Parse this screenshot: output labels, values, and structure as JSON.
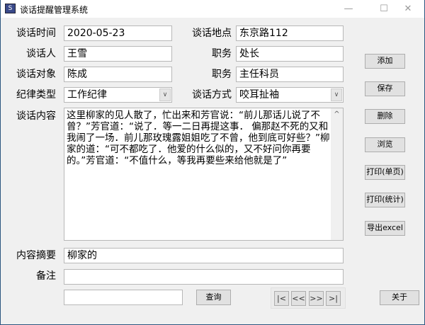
{
  "window": {
    "title": "谈话提醒管理系统",
    "icon": "app-icon",
    "minimize": "—",
    "maximize": "☐",
    "close": "✕"
  },
  "form": {
    "talk_time": {
      "label": "谈话时间",
      "value": "2020-05-23"
    },
    "talk_place": {
      "label": "谈话地点",
      "value": "东京路112"
    },
    "talker": {
      "label": "谈话人",
      "value": "王雪"
    },
    "talker_post": {
      "label": "职务",
      "value": "处长"
    },
    "target": {
      "label": "谈话对象",
      "value": "陈成"
    },
    "target_post": {
      "label": "职务",
      "value": "主任科员"
    },
    "discipline_type": {
      "label": "纪律类型",
      "value": "工作纪律"
    },
    "talk_method": {
      "label": "谈话方式",
      "value": "咬耳扯袖"
    },
    "content": {
      "label": "谈话内容",
      "value": "这里柳家的见人散了，忙出来和芳官说：“前儿那话儿说了不曾？”芳官道：“说了．等一二日再提这事．  偏那赵不死的又和我闹了一场．前儿那玫瑰露姐姐吃了不曾，他到底可好些？”柳家的道：“可不都吃了．他爱的什么似的，又不好问你再要的。”芳官道：“不值什么，等我再要些来给他就是了”"
    },
    "summary": {
      "label": "内容摘要",
      "value": "柳家的"
    },
    "remark": {
      "label": "备注",
      "value": ""
    }
  },
  "search": {
    "value": "",
    "button": "查询"
  },
  "nav": {
    "first": "|<",
    "prev": "<<",
    "next": ">>",
    "last": ">|"
  },
  "actions": {
    "add": "添加",
    "save": "保存",
    "delete": "删除",
    "browse": "浏览",
    "print_page": "打印(单页)",
    "print_stats": "打印(统计)",
    "export": "导出excel",
    "about": "关于"
  }
}
